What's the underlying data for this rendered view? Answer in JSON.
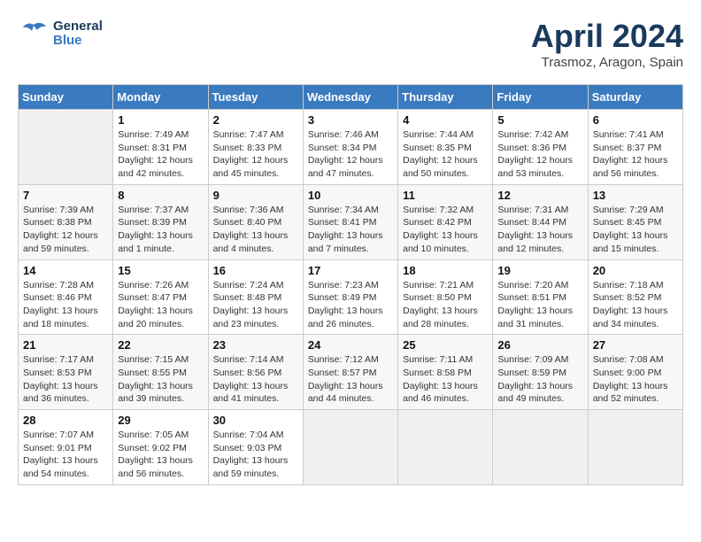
{
  "header": {
    "logo_general": "General",
    "logo_blue": "Blue",
    "month_title": "April 2024",
    "location": "Trasmoz, Aragon, Spain"
  },
  "calendar": {
    "days_of_week": [
      "Sunday",
      "Monday",
      "Tuesday",
      "Wednesday",
      "Thursday",
      "Friday",
      "Saturday"
    ],
    "weeks": [
      [
        {
          "day": "",
          "info": ""
        },
        {
          "day": "1",
          "info": "Sunrise: 7:49 AM\nSunset: 8:31 PM\nDaylight: 12 hours\nand 42 minutes."
        },
        {
          "day": "2",
          "info": "Sunrise: 7:47 AM\nSunset: 8:33 PM\nDaylight: 12 hours\nand 45 minutes."
        },
        {
          "day": "3",
          "info": "Sunrise: 7:46 AM\nSunset: 8:34 PM\nDaylight: 12 hours\nand 47 minutes."
        },
        {
          "day": "4",
          "info": "Sunrise: 7:44 AM\nSunset: 8:35 PM\nDaylight: 12 hours\nand 50 minutes."
        },
        {
          "day": "5",
          "info": "Sunrise: 7:42 AM\nSunset: 8:36 PM\nDaylight: 12 hours\nand 53 minutes."
        },
        {
          "day": "6",
          "info": "Sunrise: 7:41 AM\nSunset: 8:37 PM\nDaylight: 12 hours\nand 56 minutes."
        }
      ],
      [
        {
          "day": "7",
          "info": "Sunrise: 7:39 AM\nSunset: 8:38 PM\nDaylight: 12 hours\nand 59 minutes."
        },
        {
          "day": "8",
          "info": "Sunrise: 7:37 AM\nSunset: 8:39 PM\nDaylight: 13 hours\nand 1 minute."
        },
        {
          "day": "9",
          "info": "Sunrise: 7:36 AM\nSunset: 8:40 PM\nDaylight: 13 hours\nand 4 minutes."
        },
        {
          "day": "10",
          "info": "Sunrise: 7:34 AM\nSunset: 8:41 PM\nDaylight: 13 hours\nand 7 minutes."
        },
        {
          "day": "11",
          "info": "Sunrise: 7:32 AM\nSunset: 8:42 PM\nDaylight: 13 hours\nand 10 minutes."
        },
        {
          "day": "12",
          "info": "Sunrise: 7:31 AM\nSunset: 8:44 PM\nDaylight: 13 hours\nand 12 minutes."
        },
        {
          "day": "13",
          "info": "Sunrise: 7:29 AM\nSunset: 8:45 PM\nDaylight: 13 hours\nand 15 minutes."
        }
      ],
      [
        {
          "day": "14",
          "info": "Sunrise: 7:28 AM\nSunset: 8:46 PM\nDaylight: 13 hours\nand 18 minutes."
        },
        {
          "day": "15",
          "info": "Sunrise: 7:26 AM\nSunset: 8:47 PM\nDaylight: 13 hours\nand 20 minutes."
        },
        {
          "day": "16",
          "info": "Sunrise: 7:24 AM\nSunset: 8:48 PM\nDaylight: 13 hours\nand 23 minutes."
        },
        {
          "day": "17",
          "info": "Sunrise: 7:23 AM\nSunset: 8:49 PM\nDaylight: 13 hours\nand 26 minutes."
        },
        {
          "day": "18",
          "info": "Sunrise: 7:21 AM\nSunset: 8:50 PM\nDaylight: 13 hours\nand 28 minutes."
        },
        {
          "day": "19",
          "info": "Sunrise: 7:20 AM\nSunset: 8:51 PM\nDaylight: 13 hours\nand 31 minutes."
        },
        {
          "day": "20",
          "info": "Sunrise: 7:18 AM\nSunset: 8:52 PM\nDaylight: 13 hours\nand 34 minutes."
        }
      ],
      [
        {
          "day": "21",
          "info": "Sunrise: 7:17 AM\nSunset: 8:53 PM\nDaylight: 13 hours\nand 36 minutes."
        },
        {
          "day": "22",
          "info": "Sunrise: 7:15 AM\nSunset: 8:55 PM\nDaylight: 13 hours\nand 39 minutes."
        },
        {
          "day": "23",
          "info": "Sunrise: 7:14 AM\nSunset: 8:56 PM\nDaylight: 13 hours\nand 41 minutes."
        },
        {
          "day": "24",
          "info": "Sunrise: 7:12 AM\nSunset: 8:57 PM\nDaylight: 13 hours\nand 44 minutes."
        },
        {
          "day": "25",
          "info": "Sunrise: 7:11 AM\nSunset: 8:58 PM\nDaylight: 13 hours\nand 46 minutes."
        },
        {
          "day": "26",
          "info": "Sunrise: 7:09 AM\nSunset: 8:59 PM\nDaylight: 13 hours\nand 49 minutes."
        },
        {
          "day": "27",
          "info": "Sunrise: 7:08 AM\nSunset: 9:00 PM\nDaylight: 13 hours\nand 52 minutes."
        }
      ],
      [
        {
          "day": "28",
          "info": "Sunrise: 7:07 AM\nSunset: 9:01 PM\nDaylight: 13 hours\nand 54 minutes."
        },
        {
          "day": "29",
          "info": "Sunrise: 7:05 AM\nSunset: 9:02 PM\nDaylight: 13 hours\nand 56 minutes."
        },
        {
          "day": "30",
          "info": "Sunrise: 7:04 AM\nSunset: 9:03 PM\nDaylight: 13 hours\nand 59 minutes."
        },
        {
          "day": "",
          "info": ""
        },
        {
          "day": "",
          "info": ""
        },
        {
          "day": "",
          "info": ""
        },
        {
          "day": "",
          "info": ""
        }
      ]
    ]
  }
}
